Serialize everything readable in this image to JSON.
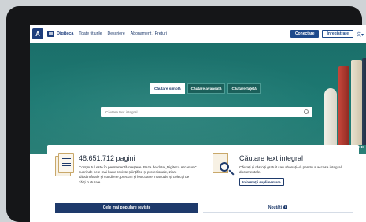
{
  "nav": {
    "logo_letter": "A",
    "brand": "Digiteca",
    "links": [
      "Toate titlurile",
      "Descriere",
      "Abonament / Prețuri"
    ],
    "login": "Conectare",
    "register": "Înregistrare",
    "lang_icon": "translate-icon",
    "lang_glyph": "文▾"
  },
  "hero": {
    "tabs": [
      {
        "label": "Căutare simplă",
        "active": true
      },
      {
        "label": "Căutare avansată",
        "active": false
      },
      {
        "label": "Căutare fațetă",
        "active": false
      }
    ],
    "search_placeholder": "Căutare text integral",
    "service_prefix": "Un serviciu",
    "service_brand": "Arcanum"
  },
  "info": {
    "stat_title": "48.651.712 pagini",
    "stat_desc": "Conținutul este în permanentă creștere. Baza de date „Digiteca Arcanum” cuprinde cele mai bune reviste științifice și profesionale, ziare săptămânale și cotidiene, precum și lexicoane, manuale și colecții de cărți culturale.",
    "ft_title": "Căutare text integral",
    "ft_desc": "Căutați și răsfoiți gratuit sau abonați-vă pentru a accesa integral documentele.",
    "ft_button": "Informații suplimentare",
    "tab_popular": "Cele mai populare reviste",
    "tab_news": "Noutăți"
  }
}
